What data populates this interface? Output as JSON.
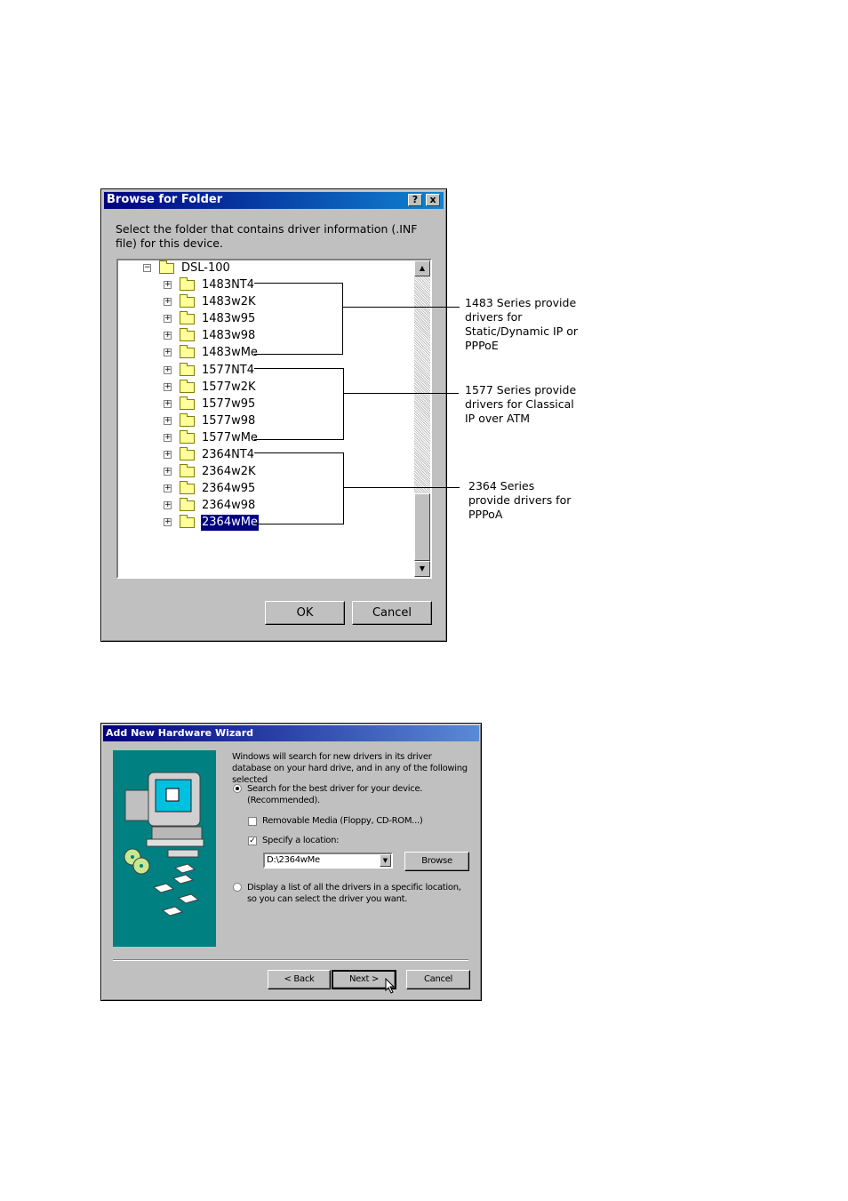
{
  "browse_dialog": {
    "title": "Browse for Folder",
    "help_button": "?",
    "close_button": "x",
    "prompt": "Select the folder that contains driver information (.INF file) for this device.",
    "root_folder": "DSL-100",
    "folders": [
      "1483NT4",
      "1483w2K",
      "1483w95",
      "1483w98",
      "1483wMe",
      "1577NT4",
      "1577w2K",
      "1577w95",
      "1577w98",
      "1577wMe",
      "2364NT4",
      "2364w2K",
      "2364w95",
      "2364w98",
      "2364wMe"
    ],
    "selected_folder": "2364wMe",
    "ok_label": "OK",
    "cancel_label": "Cancel"
  },
  "annotations": {
    "series_1483": "1483 Series provide drivers for Static/Dynamic IP or PPPoE",
    "series_1577": "1577 Series provide drivers for Classical IP over ATM",
    "series_2364": "2364 Series provide drivers for PPPoA"
  },
  "wizard": {
    "title": "Add New Hardware Wizard",
    "intro": "Windows will search for new drivers in its driver database on your hard drive, and in any of the following selected",
    "option_search": "Search for the best driver for your device. (Recommended).",
    "option_search_selected": true,
    "removable_media": "Removable Media (Floppy, CD-ROM...)",
    "removable_checked": false,
    "specify_location": "Specify a location:",
    "specify_checked": true,
    "location_value": "D:\\2364wMe",
    "browse_label": "Browse",
    "option_display": "Display a list of all the drivers in a specific location, so you can select the driver you want.",
    "back_label": "< Back",
    "next_label": "Next >",
    "cancel_label": "Cancel"
  }
}
